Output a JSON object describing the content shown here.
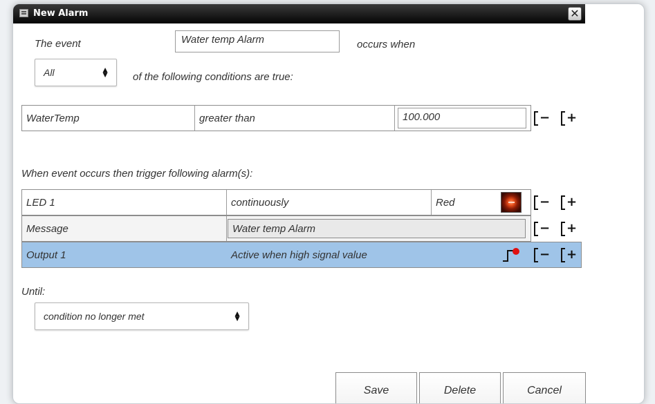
{
  "window": {
    "title": "New Alarm"
  },
  "event": {
    "label_prefix": "The event",
    "name": "Water temp Alarm",
    "label_suffix": "occurs when",
    "match_mode": "All",
    "match_suffix": "of the following conditions are  true:"
  },
  "conditions": [
    {
      "variable": "WaterTemp",
      "operator": "greater than",
      "value": "100.000"
    }
  ],
  "alarms_header": "When event occurs then trigger following alarm(s):",
  "alarms": {
    "led": {
      "name": "LED 1",
      "mode": "continuously",
      "color": "Red"
    },
    "message": {
      "name": "Message",
      "text": "Water temp Alarm"
    },
    "output": {
      "name": "Output 1",
      "mode": "Active when high signal value"
    }
  },
  "until": {
    "label": "Until:",
    "value": "condition no longer met"
  },
  "buttons": {
    "save": "Save",
    "delete": "Delete",
    "cancel": "Cancel"
  },
  "icons": {
    "remove": "remove-icon",
    "add": "add-icon",
    "led": "led-red-icon",
    "signal": "high-signal-icon",
    "close": "close-icon",
    "window": "window-icon"
  },
  "colors": {
    "selected_row": "#9fc4e8",
    "titlebar": "#0a0a0a",
    "led": "#e8501c"
  }
}
